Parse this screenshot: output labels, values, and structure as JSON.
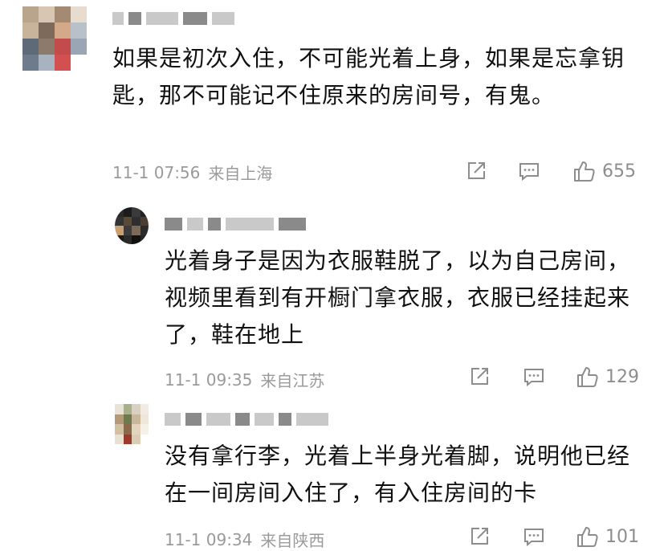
{
  "comments": [
    {
      "text": "如果是初次入住，不可能光着上身，如果是忘拿钥匙，那不可能记不住原来的房间号，有鬼。",
      "time": "11-1 07:56",
      "location": "来自上海",
      "likes": "655",
      "reply": false
    },
    {
      "text": "光着身子是因为衣服鞋脱了，以为自己房间，视频里看到有开橱门拿衣服，衣服已经挂起来了，鞋在地上",
      "time": "11-1 09:35",
      "location": "来自江苏",
      "likes": "129",
      "reply": true
    },
    {
      "text": "没有拿行李，光着上半身光着脚，说明他已经在一间房间入住了，有入住房间的卡",
      "time": "11-1 09:34",
      "location": "来自陕西",
      "likes": "101",
      "reply": true
    }
  ],
  "icons": {
    "share": "share-icon",
    "comment": "comment-icon",
    "like": "thumbs-up-icon"
  },
  "colors": {
    "text": "#111111",
    "meta": "#9a9a9a",
    "icon": "#8d8d8d"
  }
}
